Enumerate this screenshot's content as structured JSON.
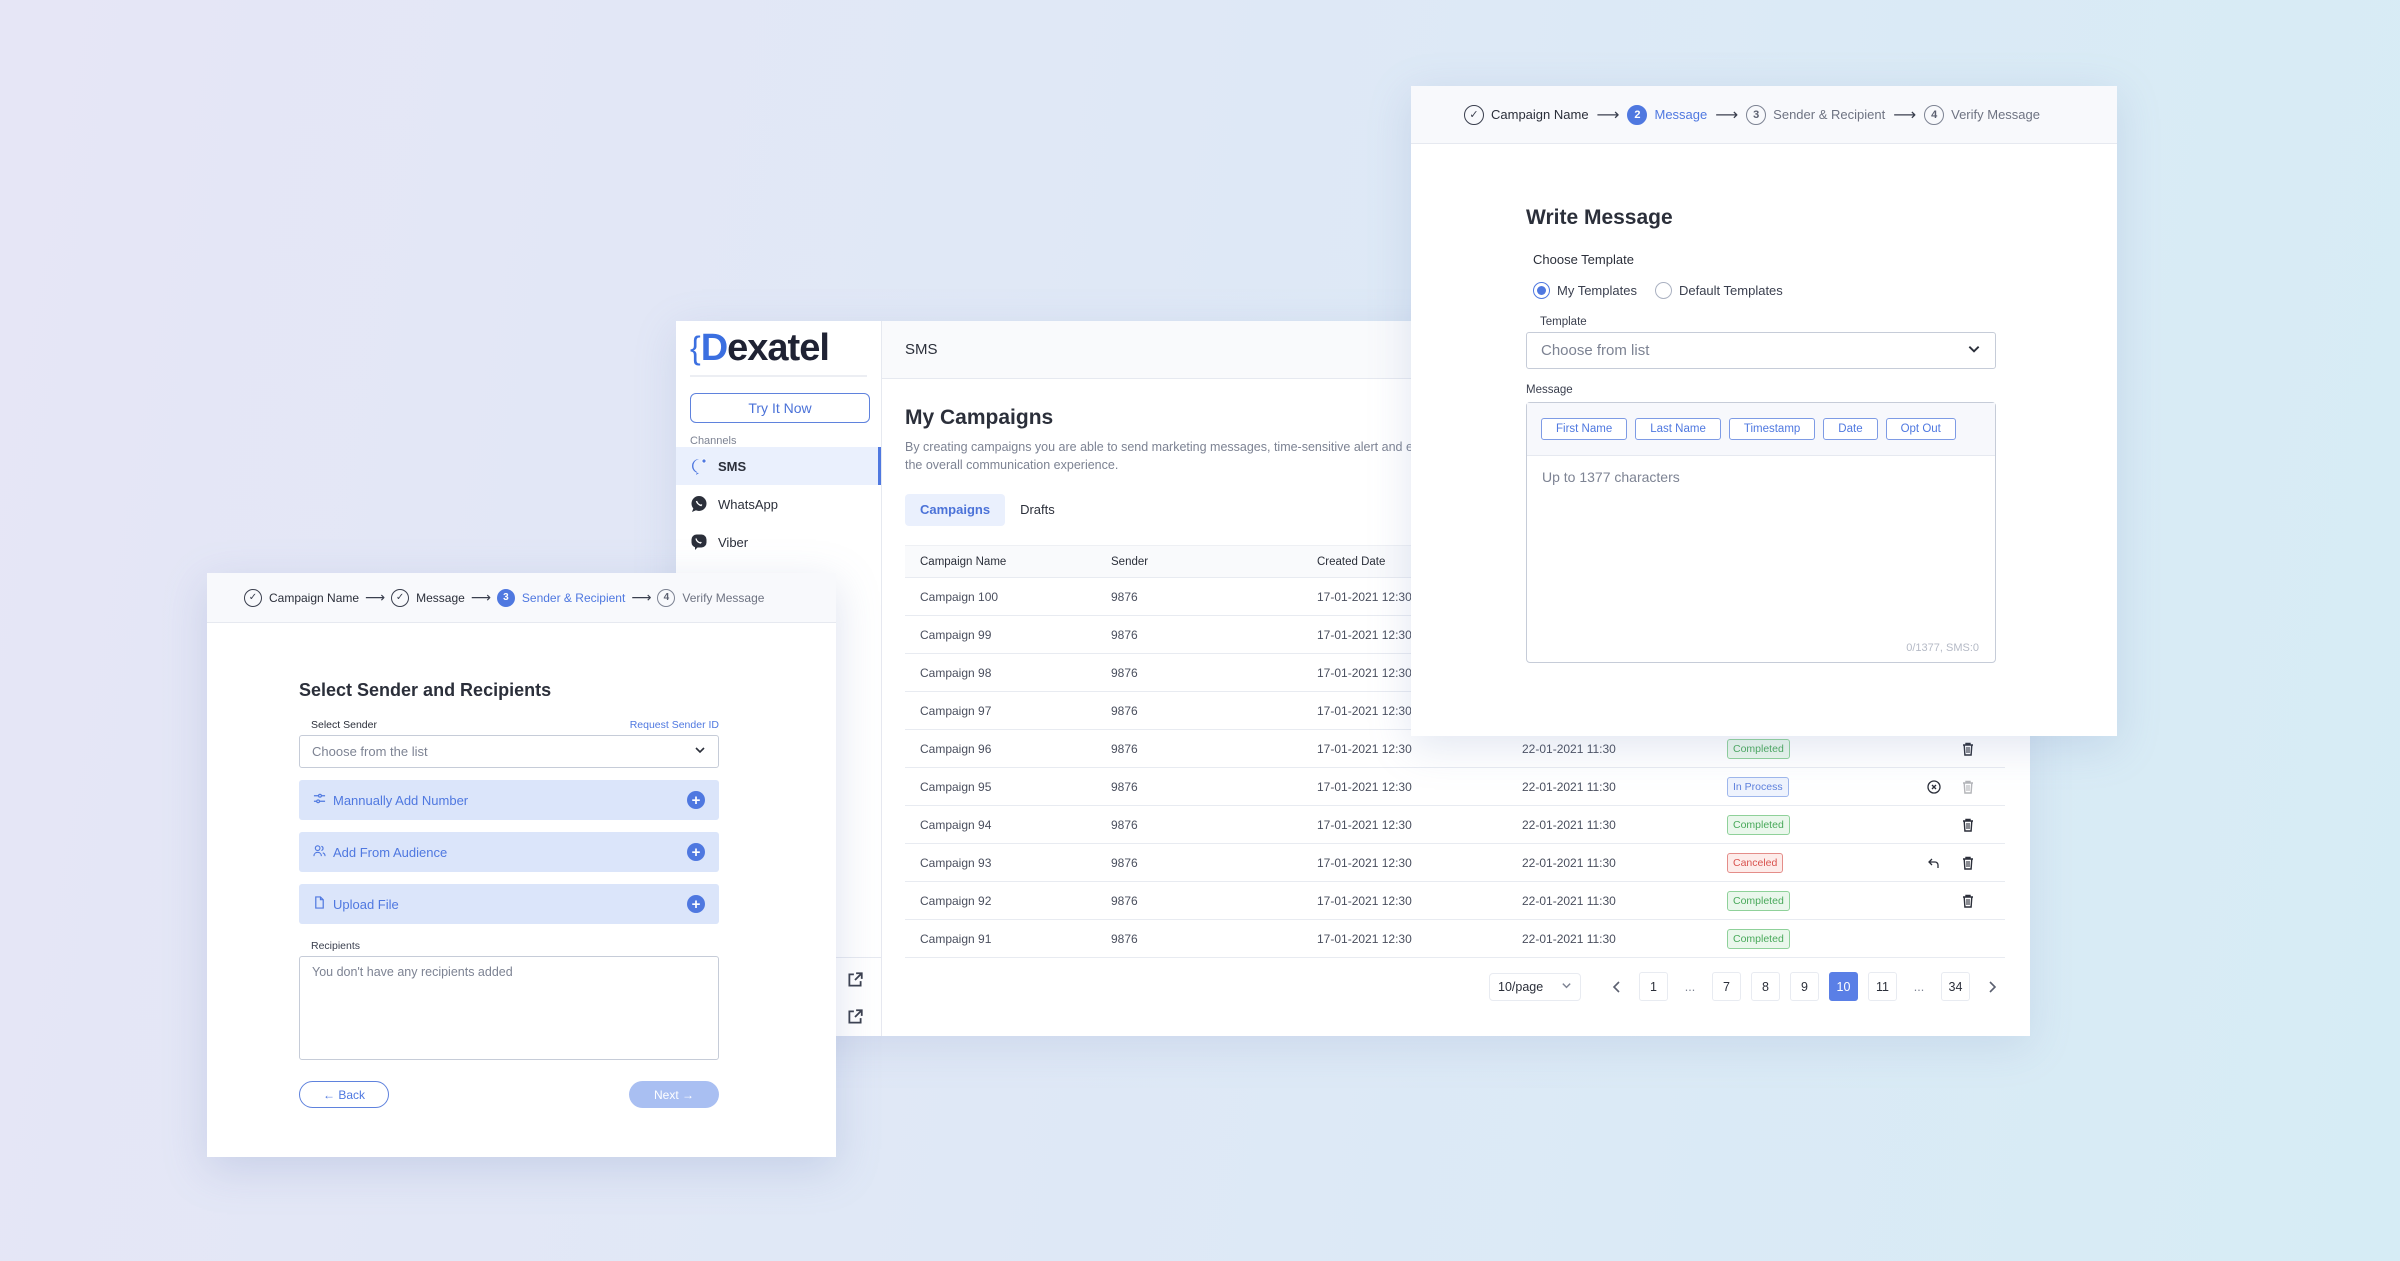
{
  "main": {
    "brand": {
      "brace": "{",
      "d": "D",
      "rest": "exatel"
    },
    "try_button": "Try It Now",
    "channels_label": "Channels",
    "channels": [
      {
        "label": "SMS",
        "icon": "sms-bubble-icon",
        "active": true
      },
      {
        "label": "WhatsApp",
        "icon": "whatsapp-icon",
        "active": false
      },
      {
        "label": "Viber",
        "icon": "viber-icon",
        "active": false
      }
    ],
    "topbar_title": "SMS",
    "page_title": "My Campaigns",
    "page_description": "By creating campaigns you are able to send marketing messages, time-sensitive alert and enhance the overall communication experience.",
    "tabs": [
      {
        "label": "Campaigns",
        "active": true
      },
      {
        "label": "Drafts",
        "active": false
      }
    ],
    "table": {
      "columns": [
        "Campaign Name",
        "Sender",
        "Created Date"
      ],
      "rows": [
        {
          "name": "Campaign 100",
          "sender": "9876",
          "created": "17-01-2021 12:30",
          "scheduled": "",
          "status": "",
          "actions": []
        },
        {
          "name": "Campaign 99",
          "sender": "9876",
          "created": "17-01-2021 12:30",
          "scheduled": "",
          "status": "",
          "actions": []
        },
        {
          "name": "Campaign 98",
          "sender": "9876",
          "created": "17-01-2021 12:30",
          "scheduled": "",
          "status": "",
          "actions": []
        },
        {
          "name": "Campaign 97",
          "sender": "9876",
          "created": "17-01-2021 12:30",
          "scheduled": "",
          "status": "",
          "actions": []
        },
        {
          "name": "Campaign 96",
          "sender": "9876",
          "created": "17-01-2021 12:30",
          "scheduled": "22-01-2021 11:30",
          "status": "Completed",
          "actions": [
            "delete"
          ]
        },
        {
          "name": "Campaign 95",
          "sender": "9876",
          "created": "17-01-2021 12:30",
          "scheduled": "22-01-2021 11:30",
          "status": "In Process",
          "actions": [
            "cancel",
            "delete-disabled"
          ]
        },
        {
          "name": "Campaign 94",
          "sender": "9876",
          "created": "17-01-2021 12:30",
          "scheduled": "22-01-2021 11:30",
          "status": "Completed",
          "actions": [
            "delete"
          ]
        },
        {
          "name": "Campaign 93",
          "sender": "9876",
          "created": "17-01-2021 12:30",
          "scheduled": "22-01-2021 11:30",
          "status": "Canceled",
          "actions": [
            "restore",
            "delete"
          ]
        },
        {
          "name": "Campaign 92",
          "sender": "9876",
          "created": "17-01-2021 12:30",
          "scheduled": "22-01-2021 11:30",
          "status": "Completed",
          "actions": [
            "delete"
          ]
        },
        {
          "name": "Campaign 91",
          "sender": "9876",
          "created": "17-01-2021 12:30",
          "scheduled": "22-01-2021 11:30",
          "status": "Completed",
          "actions": []
        }
      ]
    },
    "pagination": {
      "per_page": "10/page",
      "pages": [
        "1",
        "...",
        "7",
        "8",
        "9",
        "10",
        "11",
        "...",
        "34"
      ],
      "current": "10"
    }
  },
  "message_window": {
    "steps": [
      {
        "label": "Campaign Name",
        "marker": "✓",
        "state": "done"
      },
      {
        "label": "Message",
        "marker": "2",
        "state": "active"
      },
      {
        "label": "Sender & Recipient",
        "marker": "3",
        "state": "pending"
      },
      {
        "label": "Verify Message",
        "marker": "4",
        "state": "pending"
      }
    ],
    "title": "Write Message",
    "choose_template_label": "Choose Template",
    "radio_options": [
      {
        "label": "My Templates",
        "checked": true
      },
      {
        "label": "Default Templates",
        "checked": false
      }
    ],
    "template_label": "Template",
    "template_placeholder": "Choose from list",
    "message_label": "Message",
    "tags": [
      "First Name",
      "Last Name",
      "Timestamp",
      "Date",
      "Opt Out"
    ],
    "message_placeholder": "Up to 1377 characters",
    "counter": "0/1377, SMS:0"
  },
  "sender_window": {
    "steps": [
      {
        "label": "Campaign Name",
        "marker": "✓",
        "state": "done"
      },
      {
        "label": "Message",
        "marker": "✓",
        "state": "done"
      },
      {
        "label": "Sender & Recipient",
        "marker": "3",
        "state": "active"
      },
      {
        "label": "Verify Message",
        "marker": "4",
        "state": "pending"
      }
    ],
    "title": "Select Sender and Recipients",
    "select_sender_label": "Select Sender",
    "request_sender_link": "Request Sender ID",
    "sender_placeholder": "Choose from the list",
    "options": [
      {
        "label": "Mannually Add Number",
        "icon": "manual-input-icon"
      },
      {
        "label": "Add From Audience",
        "icon": "audience-icon"
      },
      {
        "label": "Upload File",
        "icon": "file-icon"
      }
    ],
    "recipients_label": "Recipients",
    "recipients_placeholder": "You don't have any recipients added",
    "back_button": "← Back",
    "next_button": "Next →"
  },
  "colors": {
    "accent": "#4f78e0",
    "completed": "#49a95b",
    "in_process": "#5f82dd",
    "canceled": "#d9534f"
  }
}
